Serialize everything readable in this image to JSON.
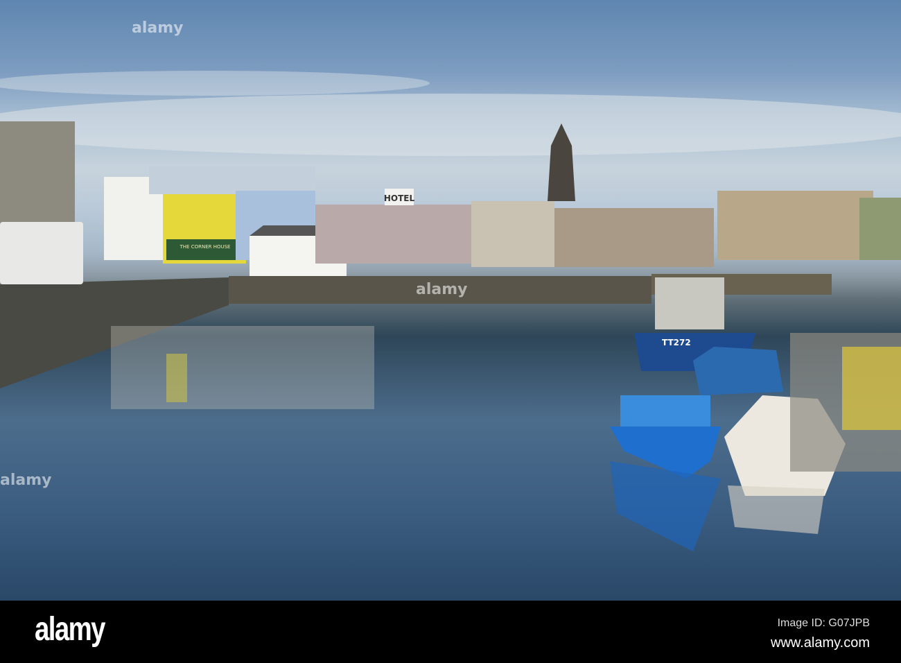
{
  "photo": {
    "signs": {
      "hotel": "HOTEL",
      "pub": "THE CORNER HOUSE",
      "boat_reg": "TT272"
    }
  },
  "watermark": {
    "overlay": "alamy"
  },
  "footer": {
    "logo": "alamy",
    "image_id": "Image ID: G07JPB",
    "website": "www.alamy.com"
  }
}
